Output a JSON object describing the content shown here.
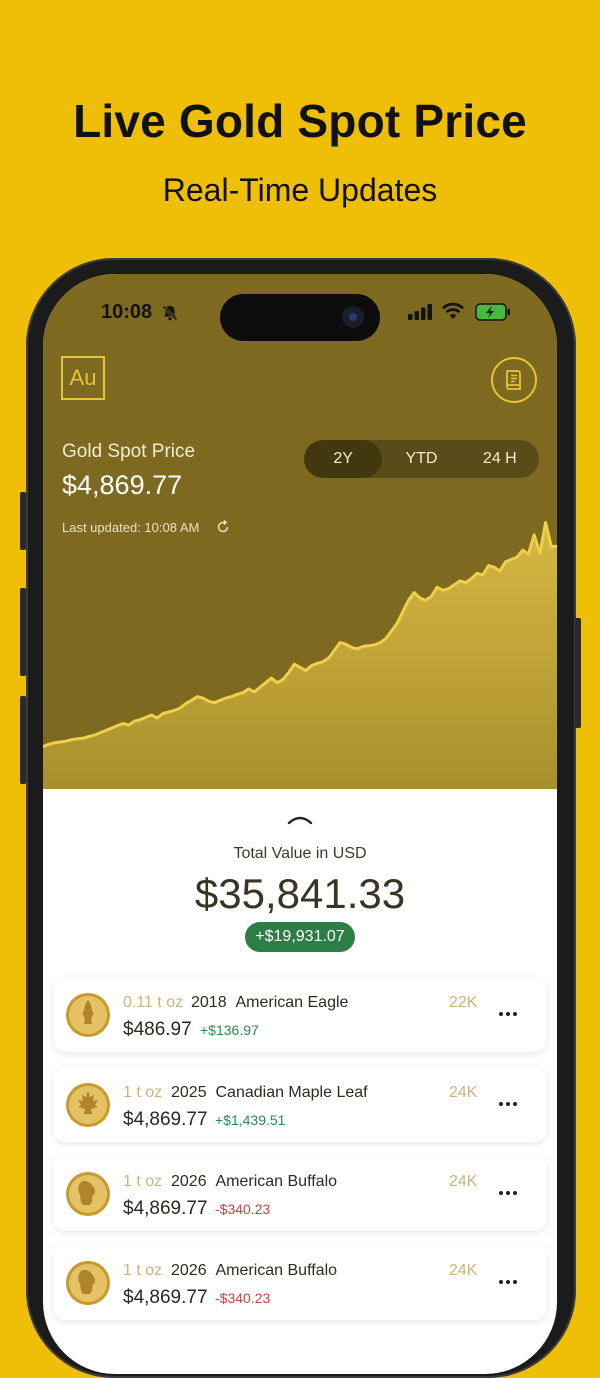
{
  "promo": {
    "headline": "Live Gold Spot Price",
    "subheadline": "Real-Time Updates"
  },
  "status_bar": {
    "time": "10:08",
    "icons": [
      "bell-slash-icon",
      "signal-icon",
      "wifi-icon",
      "battery-charging-icon"
    ]
  },
  "header": {
    "logo_text": "Au",
    "right_button_icon": "book-icon"
  },
  "spot": {
    "label": "Gold Spot Price",
    "value": "$4,869.77",
    "last_updated": "Last updated: 10:08 AM",
    "ranges": [
      "2Y",
      "YTD",
      "24 H"
    ],
    "selected_range": "2Y"
  },
  "chart_data": {
    "type": "area",
    "series": [
      {
        "values": [
          2050,
          2080,
          2100,
          2110,
          2120,
          2140,
          2150,
          2160,
          2180,
          2200,
          2230,
          2260,
          2290,
          2320,
          2350,
          2330,
          2380,
          2400,
          2430,
          2460,
          2420,
          2480,
          2500,
          2520,
          2550,
          2610,
          2650,
          2700,
          2680,
          2640,
          2620,
          2650,
          2680,
          2700,
          2730,
          2750,
          2800,
          2760,
          2820,
          2880,
          2940,
          2880,
          2920,
          3010,
          3120,
          3080,
          3040,
          3100,
          3130,
          3150,
          3200,
          3300,
          3400,
          3380,
          3340,
          3320,
          3350,
          3360,
          3370,
          3400,
          3450,
          3550,
          3650,
          3800,
          3950,
          4050,
          3980,
          3950,
          4000,
          4120,
          4080,
          4100,
          4150,
          4200,
          4180,
          4230,
          4300,
          4280,
          4400,
          4380,
          4330,
          4450,
          4480,
          4510,
          4600,
          4550,
          4800,
          4560,
          4960,
          4650,
          4650
        ]
      }
    ],
    "colors": {
      "line": "#F0CF4A",
      "fill_top": "#D6B843",
      "fill_bottom": "#A8902C",
      "background": "#7D6A20"
    }
  },
  "portfolio": {
    "collapse_icon": "chevron-up-icon",
    "total_label": "Total Value in USD",
    "total_value": "$35,841.33",
    "total_gain": "+$19,931.07"
  },
  "holdings": [
    {
      "weight": "0.11 t oz",
      "year": "2018",
      "name": "American Eagle",
      "price": "$486.97",
      "change": "+$136.97",
      "change_sign": "positive",
      "karat": "22K",
      "coin_icon": "american-eagle-coin-icon"
    },
    {
      "weight": "1 t oz",
      "year": "2025",
      "name": "Canadian Maple Leaf",
      "price": "$4,869.77",
      "change": "+$1,439.51",
      "change_sign": "positive",
      "karat": "24K",
      "coin_icon": "maple-leaf-coin-icon"
    },
    {
      "weight": "1 t oz",
      "year": "2026",
      "name": "American Buffalo",
      "price": "$4,869.77",
      "change": "-$340.23",
      "change_sign": "negative",
      "karat": "24K",
      "coin_icon": "american-buffalo-coin-icon"
    },
    {
      "weight": "1 t oz",
      "year": "2026",
      "name": "American Buffalo",
      "price": "$4,869.77",
      "change": "-$340.23",
      "change_sign": "negative",
      "karat": "24K",
      "coin_icon": "american-buffalo-coin-icon"
    }
  ],
  "colors": {
    "background": "#EFBE06",
    "accent_gold": "#E9C23A",
    "positive": "#2E8A4A",
    "negative": "#C8453D",
    "gain_badge": "#2E7D45"
  }
}
